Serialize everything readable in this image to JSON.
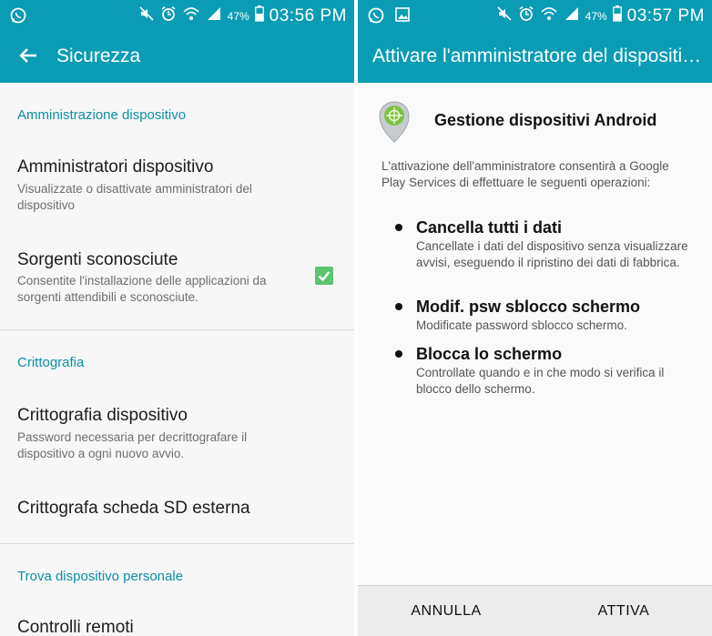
{
  "status_bar_left": {
    "clock": "03:56 PM",
    "battery_percent": "47%"
  },
  "status_bar_right": {
    "clock": "03:57 PM",
    "battery_percent": "47%"
  },
  "left_screen": {
    "title": "Sicurezza",
    "sections": [
      {
        "header": "Amministrazione dispositivo"
      },
      {
        "header": "Crittografia"
      },
      {
        "header": "Trova dispositivo personale"
      }
    ],
    "items": [
      {
        "title": "Amministratori dispositivo",
        "subtitle": "Visualizzate o disattivate amministratori del dispositivo"
      },
      {
        "title": "Sorgenti sconosciute",
        "subtitle": "Consentite l'installazione delle applicazioni da sorgenti attendibili e sconosciute.",
        "checked": true
      },
      {
        "title": "Crittografia dispositivo",
        "subtitle": "Password necessaria per decrittografare il dispositivo a ogni nuovo avvio."
      },
      {
        "title": "Crittografa scheda SD esterna"
      },
      {
        "title": "Controlli remoti"
      }
    ]
  },
  "right_screen": {
    "title": "Attivare l'amministratore del dispositivo",
    "app_name": "Gestione dispositivi Android",
    "intro": "L'attivazione dell'amministratore consentirà a Google Play Services di effettuare le seguenti operazioni:",
    "permissions": [
      {
        "title": "Cancella tutti i dati",
        "desc": "Cancellate i dati del dispositivo senza visualizzare avvisi, eseguendo il ripristino dei dati di fabbrica."
      },
      {
        "title": "Modif. psw sblocco schermo",
        "desc": "Modificate password sblocco schermo."
      },
      {
        "title": "Blocca lo schermo",
        "desc": "Controllate quando e in che modo si verifica il blocco dello schermo."
      }
    ],
    "buttons": {
      "cancel": "ANNULLA",
      "activate": "ATTIVA"
    }
  },
  "colors": {
    "accent": "#0a9cb5",
    "section_header": "#0a8fa6",
    "checkbox": "#5cc36e"
  },
  "icons": [
    "whatsapp-icon",
    "gallery-icon",
    "mute-icon",
    "alarm-icon",
    "wifi-icon",
    "signal-icon",
    "battery-icon",
    "back-arrow-icon",
    "checkmark-icon",
    "android-device-manager-icon"
  ]
}
